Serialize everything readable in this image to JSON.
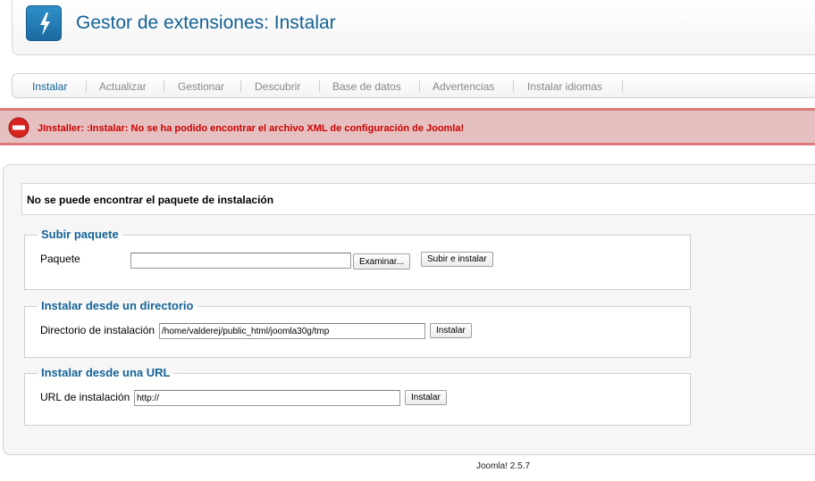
{
  "header": {
    "title": "Gestor de extensiones: Instalar",
    "icon": "extension-install-icon"
  },
  "tabs": [
    {
      "label": "Instalar",
      "active": true
    },
    {
      "label": "Actualizar",
      "active": false
    },
    {
      "label": "Gestionar",
      "active": false
    },
    {
      "label": "Descubrir",
      "active": false
    },
    {
      "label": "Base de datos",
      "active": false
    },
    {
      "label": "Advertencias",
      "active": false
    },
    {
      "label": "Instalar idiomas",
      "active": false
    }
  ],
  "error": {
    "icon": "error-stop-icon",
    "message": "JInstaller: :Instalar: No se ha podido encontrar el archivo XML de configuración de Joomla!"
  },
  "notice": {
    "message": "No se puede encontrar el paquete de instalación"
  },
  "upload": {
    "legend": "Subir paquete",
    "label": "Paquete",
    "value": "",
    "browse_label": "Examinar...",
    "submit_label": "Subir e instalar"
  },
  "directory": {
    "legend": "Instalar desde un directorio",
    "label": "Directorio de instalación",
    "value": "/home/valderej/public_html/joomla30g/tmp",
    "submit_label": "Instalar"
  },
  "url": {
    "legend": "Instalar desde una URL",
    "label": "URL de instalación",
    "value": "http://",
    "submit_label": "Instalar"
  },
  "footer": {
    "version": "Joomla! 2.5.7"
  },
  "colors": {
    "title": "#146295",
    "error_text": "#cc0000",
    "error_bg": "#e6c0c0",
    "error_border": "#de7a7b"
  }
}
